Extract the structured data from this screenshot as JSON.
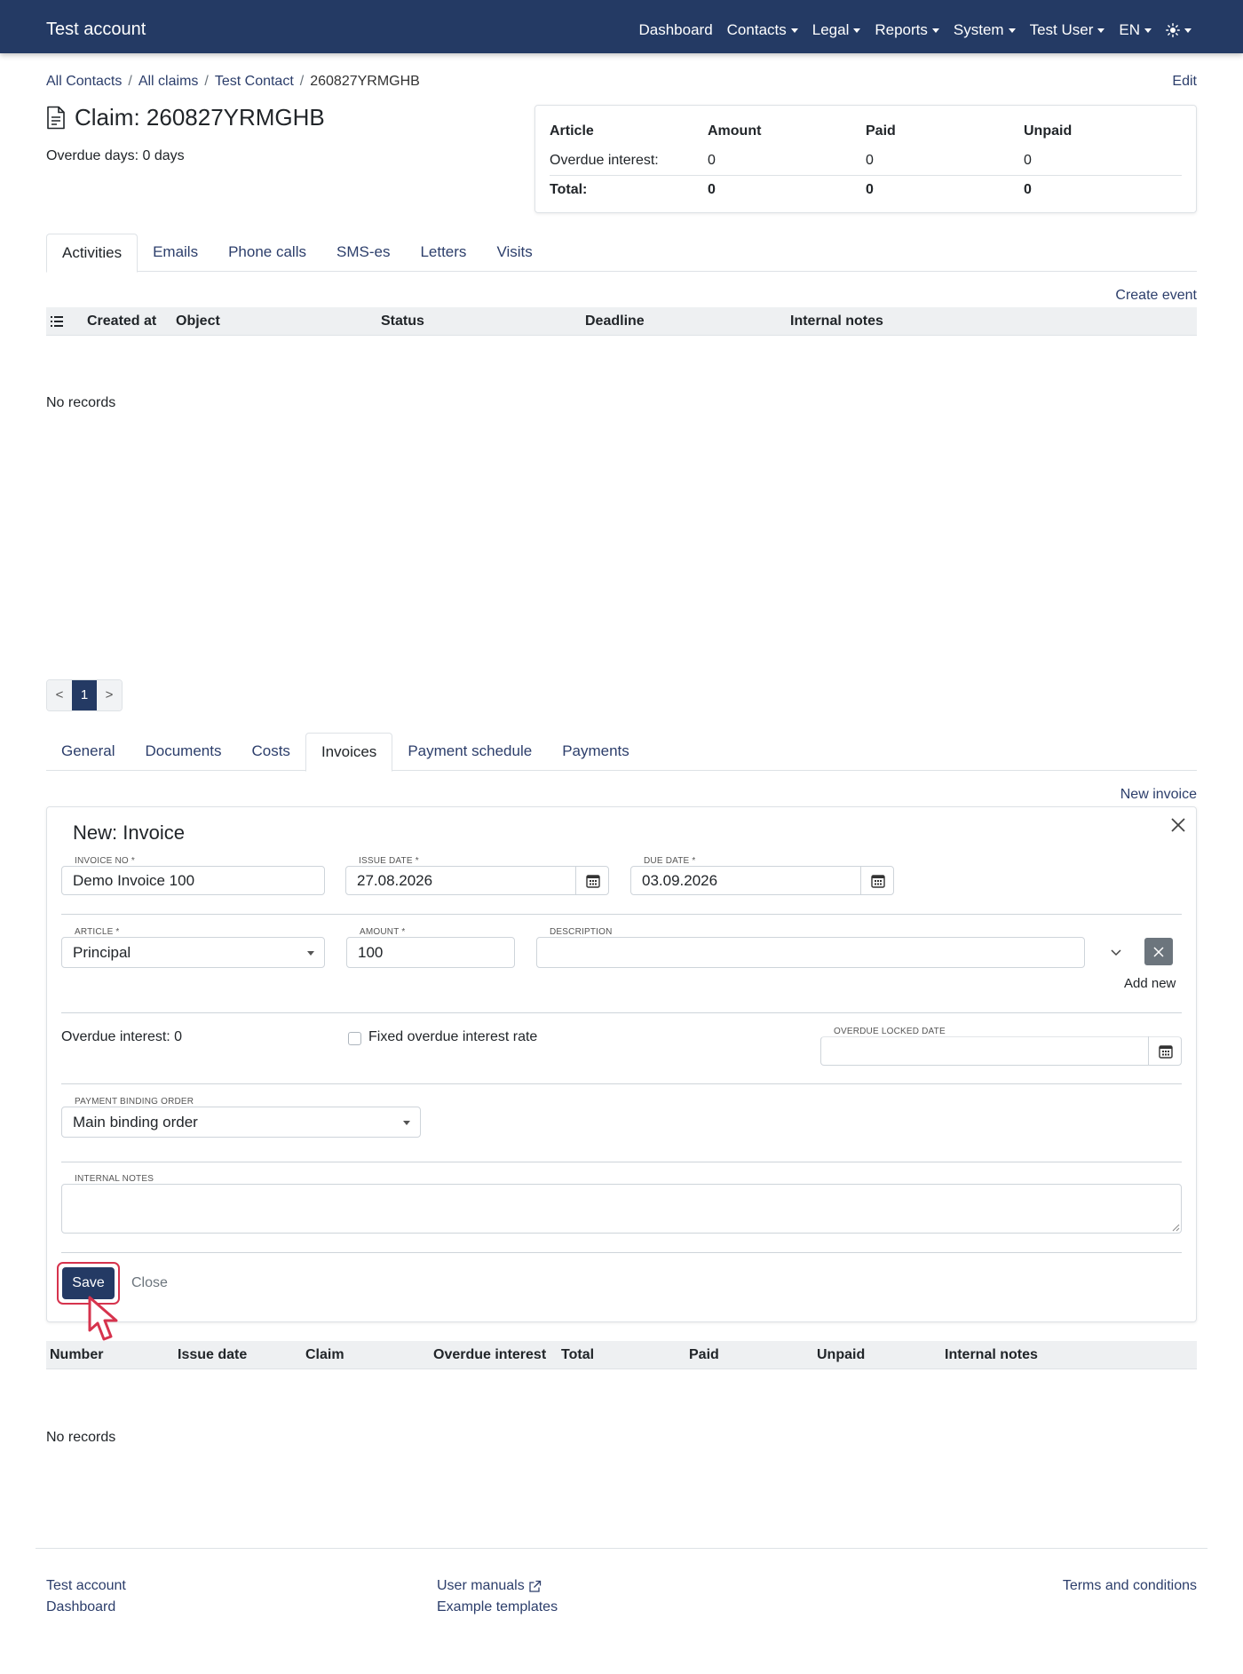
{
  "navbar": {
    "brand": "Test account",
    "items": [
      "Dashboard",
      "Contacts",
      "Legal",
      "Reports",
      "System",
      "Test User",
      "EN"
    ]
  },
  "breadcrumb": [
    "All Contacts",
    "All claims",
    "Test Contact",
    "260827YRMGHB"
  ],
  "edit_label": "Edit",
  "claim": {
    "title": "Claim: 260827YRMGHB",
    "overdue_days": "Overdue days: 0 days"
  },
  "summary": {
    "headers": [
      "Article",
      "Amount",
      "Paid",
      "Unpaid"
    ],
    "rows": [
      [
        "Overdue interest:",
        "0",
        "0",
        "0"
      ]
    ],
    "total": [
      "Total:",
      "0",
      "0",
      "0"
    ]
  },
  "activity_tabs": [
    "Activities",
    "Emails",
    "Phone calls",
    "SMS-es",
    "Letters",
    "Visits"
  ],
  "create_event_label": "Create event",
  "activities_table": {
    "headers": [
      "Created at",
      "Object",
      "Status",
      "Deadline",
      "Internal notes"
    ],
    "empty": "No records"
  },
  "pagination": {
    "prev": "<",
    "page": "1",
    "next": ">"
  },
  "detail_tabs": [
    "General",
    "Documents",
    "Costs",
    "Invoices",
    "Payment schedule",
    "Payments"
  ],
  "new_invoice_label": "New invoice",
  "invoice_form": {
    "title": "New: Invoice",
    "invoice_no": {
      "label": "INVOICE NO *",
      "value": "Demo Invoice 100"
    },
    "issue_date": {
      "label": "ISSUE DATE *",
      "value": "27.08.2026"
    },
    "due_date": {
      "label": "DUE DATE *",
      "value": "03.09.2026"
    },
    "article": {
      "label": "ARTICLE *",
      "value": "Principal"
    },
    "amount": {
      "label": "AMOUNT *",
      "value": "100"
    },
    "description": {
      "label": "DESCRIPTION",
      "value": ""
    },
    "add_new": "Add new",
    "overdue_interest": "Overdue interest: 0",
    "fixed_rate_label": "Fixed overdue interest rate",
    "fixed_rate_checked": false,
    "overdue_locked_date": {
      "label": "OVERDUE LOCKED DATE",
      "value": ""
    },
    "payment_binding_order": {
      "label": "PAYMENT BINDING ORDER",
      "value": "Main binding order"
    },
    "internal_notes": {
      "label": "INTERNAL NOTES",
      "value": ""
    },
    "save_label": "Save",
    "close_label": "Close"
  },
  "invoices_table": {
    "headers": [
      "Number",
      "Issue date",
      "Claim",
      "Overdue interest",
      "Total",
      "Paid",
      "Unpaid",
      "Internal notes"
    ],
    "empty": "No records"
  },
  "footer": {
    "col1": [
      "Test account",
      "Dashboard"
    ],
    "col2": [
      "User manuals",
      "Example templates"
    ],
    "col3": [
      "Terms and conditions"
    ]
  },
  "colors": {
    "navbar": "#243a64",
    "accent": "#d6334d"
  }
}
